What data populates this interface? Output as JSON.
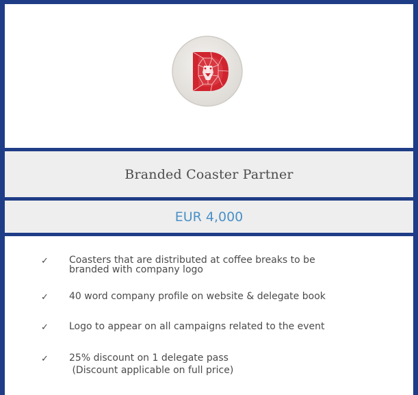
{
  "package": {
    "title": "Branded Coaster Partner",
    "price": "EUR 4,000",
    "image_icon": "lion-d-coaster-logo",
    "features": [
      {
        "check": "✓",
        "lines": [
          "Coasters that are distributed at coffee breaks to be",
          "branded with company logo"
        ]
      },
      {
        "check": "✓",
        "lines": [
          "40 word company profile on website & delegate book"
        ]
      },
      {
        "check": "✓",
        "lines": [
          "Logo to appear on all campaigns related to the event"
        ]
      },
      {
        "check": "✓",
        "lines": [
          "25% discount on 1 delegate pass",
          " (Discount applicable on full price)"
        ]
      }
    ]
  },
  "colors": {
    "border": "#1f3c86",
    "price": "#4a90c8",
    "text": "#4a4a4a",
    "logo": "#d0242f"
  }
}
